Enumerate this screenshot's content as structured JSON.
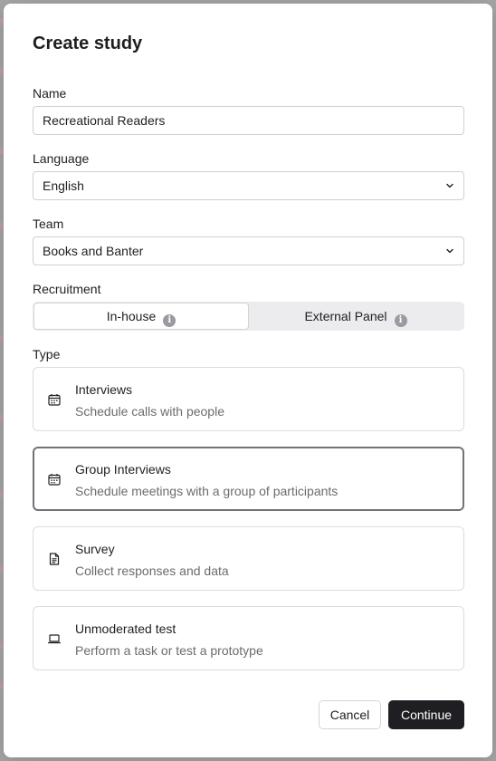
{
  "modal": {
    "title": "Create study",
    "name": {
      "label": "Name",
      "value": "Recreational Readers"
    },
    "language": {
      "label": "Language",
      "value": "English"
    },
    "team": {
      "label": "Team",
      "value": "Books and Banter"
    },
    "recruitment": {
      "label": "Recruitment",
      "options": [
        {
          "label": "In-house",
          "selected": true
        },
        {
          "label": "External Panel",
          "selected": false
        }
      ]
    },
    "type": {
      "label": "Type",
      "options": [
        {
          "title": "Interviews",
          "description": "Schedule calls with people",
          "icon": "calendar-icon",
          "selected": false
        },
        {
          "title": "Group Interviews",
          "description": "Schedule meetings with a group of participants",
          "icon": "calendar-icon",
          "selected": true
        },
        {
          "title": "Survey",
          "description": "Collect responses and data",
          "icon": "document-icon",
          "selected": false
        },
        {
          "title": "Unmoderated test",
          "description": "Perform a task or test a prototype",
          "icon": "laptop-icon",
          "selected": false
        }
      ]
    },
    "buttons": {
      "cancel": "Cancel",
      "continue": "Continue"
    }
  },
  "colors": {
    "primary_button": "#1f1f23",
    "selected_border": "#727278",
    "muted_text": "#6b6b72"
  }
}
